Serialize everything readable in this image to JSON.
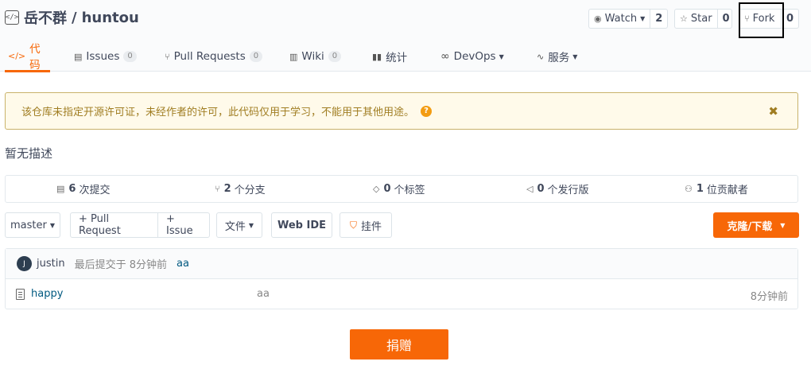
{
  "repo": {
    "owner": "岳不群",
    "separator": "/",
    "name": "huntou"
  },
  "actions": {
    "watch": {
      "label": "Watch",
      "count": "2"
    },
    "star": {
      "label": "Star",
      "count": "0"
    },
    "fork": {
      "label": "Fork",
      "count": "0"
    }
  },
  "tabs": [
    {
      "label": "代码",
      "icon": "code-icon"
    },
    {
      "label": "Issues",
      "badge": "0",
      "icon": "issues-icon"
    },
    {
      "label": "Pull Requests",
      "badge": "0",
      "icon": "pull-request-icon"
    },
    {
      "label": "Wiki",
      "badge": "0",
      "icon": "wiki-icon"
    },
    {
      "label": "统计",
      "icon": "stats-icon"
    },
    {
      "label": "DevOps",
      "icon": "devops-icon"
    },
    {
      "label": "服务",
      "icon": "service-icon"
    }
  ],
  "notice": {
    "text": "该仓库未指定开源许可证，未经作者的许可，此代码仅用于学习，不能用于其他用途。",
    "help": "?",
    "close": "✖"
  },
  "description": "暂无描述",
  "stats": [
    {
      "count": "6",
      "label": "次提交"
    },
    {
      "count": "2",
      "label": "个分支"
    },
    {
      "count": "0",
      "label": "个标签"
    },
    {
      "count": "0",
      "label": "个发行版"
    },
    {
      "count": "1",
      "label": "位贡献者"
    }
  ],
  "toolbar": {
    "branch": "master",
    "pull_request": "+ Pull Request",
    "issue": "+ Issue",
    "file": "文件",
    "web_ide": "Web IDE",
    "plugin": "挂件",
    "clone": "克隆/下载"
  },
  "commit": {
    "avatar": "J",
    "author": "justin",
    "meta": "最后提交于 8分钟前",
    "message": "aa"
  },
  "files": [
    {
      "name": "happy",
      "message": "aa",
      "time": "8分钟前"
    }
  ],
  "donate": "捐赠",
  "colors": {
    "accent": "#f76707",
    "link": "#005980",
    "notice_bg": "#fffaea"
  }
}
